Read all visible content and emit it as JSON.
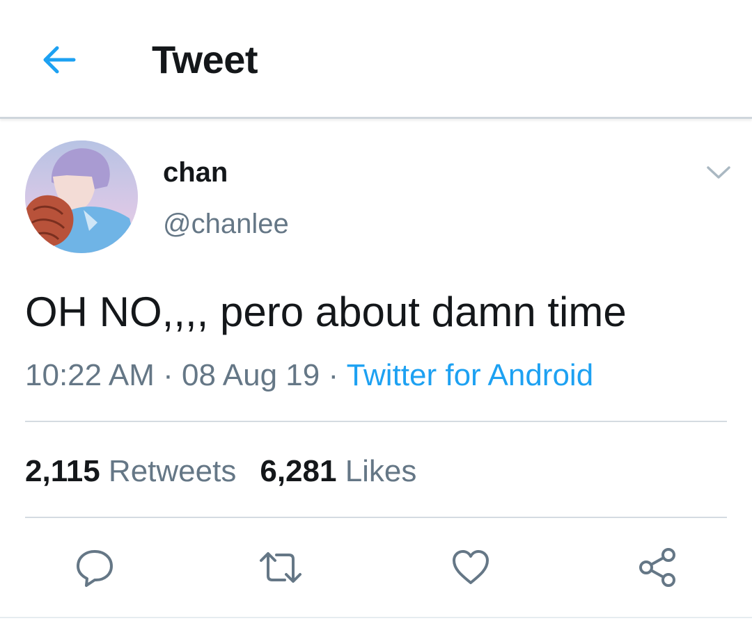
{
  "header": {
    "title": "Tweet",
    "back_icon": "arrow-left-icon"
  },
  "author": {
    "display_name": "chan",
    "handle": "@chanlee"
  },
  "tweet": {
    "text": "OH NO,,,, pero about damn time",
    "time": "10:22 AM",
    "separator": "·",
    "date": "08 Aug 19",
    "source": "Twitter for Android"
  },
  "stats": {
    "retweets_count": "2,115",
    "retweets_label": "Retweets",
    "likes_count": "6,281",
    "likes_label": "Likes"
  },
  "actions": [
    "reply-icon",
    "retweet-icon",
    "like-icon",
    "share-icon"
  ],
  "colors": {
    "accent": "#1da1f2",
    "text": "#14171a",
    "secondary_text": "#657786",
    "divider": "#d4dbe1",
    "icon": "#657786"
  }
}
